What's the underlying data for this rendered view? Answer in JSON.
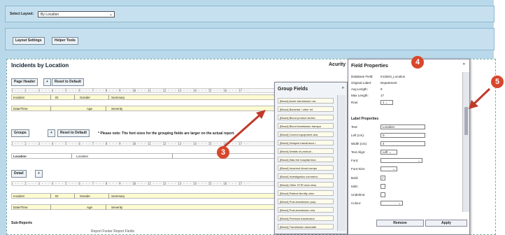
{
  "toolbar": {
    "select_label": "Select Layout:",
    "select_value": "By Location",
    "layout_settings": "Layout Settings",
    "helper_tools": "Helper Tools"
  },
  "main": {
    "title": "Incidents by Location",
    "acuity": "Acurity",
    "page_header": {
      "label": "Page Header",
      "reset": "Reset to Default",
      "row1": [
        "Incident",
        "ID",
        "Gender",
        "Summary"
      ],
      "row2": [
        "Date/Time",
        "Age",
        "Severity"
      ]
    },
    "groups": {
      "label": "Groups",
      "reset": "Reset to Default",
      "note": "* Please note: The font sizes for the grouping fields are larger on the actual report.",
      "row": [
        "Location",
        "Location"
      ]
    },
    "detail": {
      "label": "Detail",
      "row1": [
        "Incident",
        "ID",
        "Gender",
        "Summary"
      ],
      "row2": [
        "Date/Time",
        "Age",
        "Severity"
      ]
    },
    "subreports": "Sub-Reports",
    "footer_text": "Report Footer   Report Fields"
  },
  "ruler": "1 · · · 2 · · · 3 · · · 4 · · · 5 · · · 6 · · · 7 · · · 8 · · · 9 · · · 10 · · · 11 · · · 12 · · · 13 · · · 14 · · · 15 · · · 16 · · · 17 · ·",
  "group_fields": {
    "title": "Group Fields",
    "items": [
      "[Blood] Acute transfusion rea",
      "[Blood] Bacterial / other inf",
      "[Blood] Blood product stored",
      "[Blood] Blood transfusion transpo",
      "[Blood] Correct equipment ava",
      "[Blood] Delayed transfusion r",
      "[Blood] Details of product -",
      "[Blood] Was the hospital bloo",
      "[Blood] Incorrect blood compo",
      "[Blood] Investigation commenc",
      "[Blood] Other STIR near miss",
      "[Blood] Patient identity chec",
      "[Blood] Post-transfusion purp",
      "[Blood] Post-transfusion vira",
      "[Blood] Previous transfusion",
      "[Blood] Transfusion associate"
    ]
  },
  "field_properties": {
    "title": "Field Properties",
    "info": [
      {
        "k": "Database Field:",
        "v": "Incident_Location"
      },
      {
        "k": "Original Label:",
        "v": "Department"
      },
      {
        "k": "Avg Length:",
        "v": "9"
      },
      {
        "k": "Max Length:",
        "v": "17"
      }
    ],
    "row_label": "Row:",
    "row_value": "1",
    "label_props": "Label Properties",
    "text_label": "Text:",
    "text_value": "Location",
    "left_label": "Left (cm):",
    "left_value": "0",
    "width_label": "Width (cm):",
    "width_value": "4",
    "align_label": "Text Align:",
    "align_value": "Left",
    "font_label": "Font:",
    "size_label": "Font Size:",
    "bold_label": "Bold:",
    "italic_label": "Italic:",
    "underline_label": "Underline:",
    "colour_label": "Colour:",
    "remove": "Remove",
    "apply": "Apply"
  },
  "callouts": {
    "c3": "3",
    "c4": "4",
    "c5": "5"
  },
  "colors": {
    "accent": "#d8462b",
    "panel": "#c6e0ef",
    "band": "#fdfbd0"
  }
}
